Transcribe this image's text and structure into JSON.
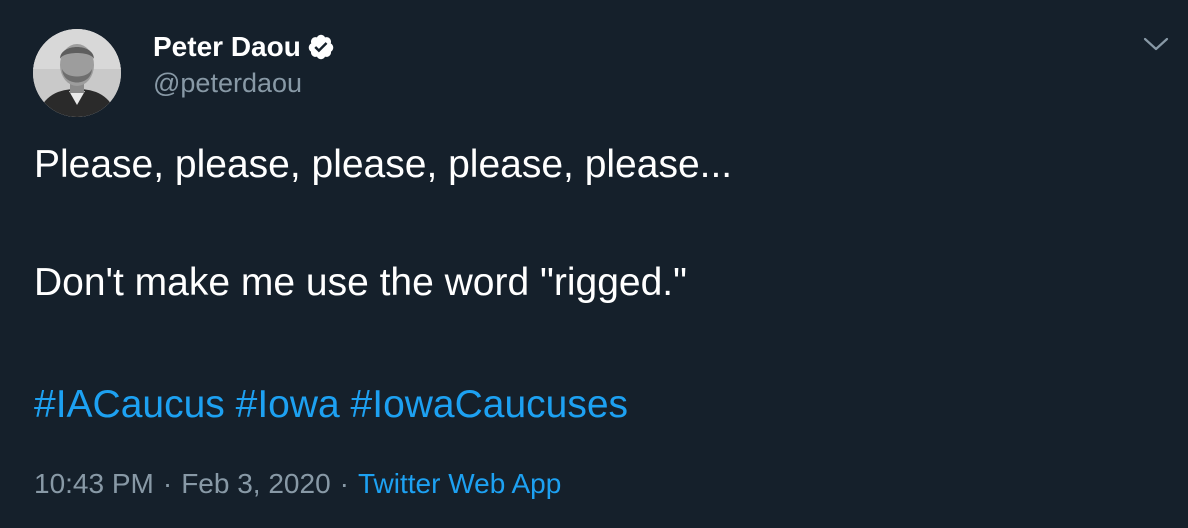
{
  "author": {
    "display_name": "Peter Daou",
    "handle": "@peterdaou",
    "verified": true,
    "avatar_icon": "profile-photo-icon"
  },
  "tweet": {
    "line1": "Please, please, please, please, please...",
    "line2": "Don't make me use the word \"rigged.\"",
    "hashtags": [
      "#IACaucus",
      "#Iowa",
      "#IowaCaucuses"
    ]
  },
  "meta": {
    "time": "10:43 PM",
    "separator": "·",
    "date": "Feb 3, 2020",
    "source": "Twitter Web App"
  },
  "colors": {
    "background": "#15202b",
    "text": "#ffffff",
    "secondary": "#8899a6",
    "accent": "#1da1f2"
  },
  "icons": {
    "verified": "verified-badge-icon",
    "more": "chevron-down-icon"
  }
}
